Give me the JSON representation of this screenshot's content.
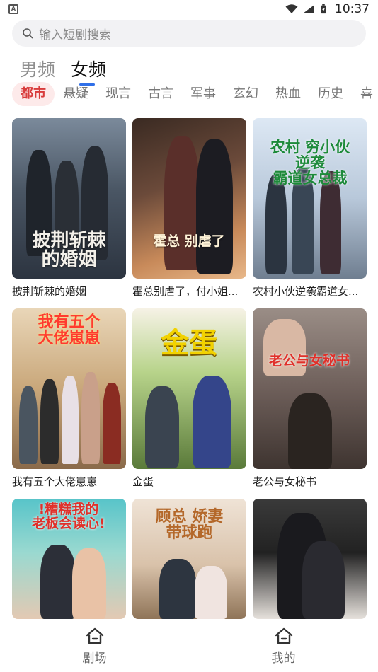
{
  "status_bar": {
    "time": "10:37",
    "app_icon_letter": "A"
  },
  "search": {
    "placeholder": "输入短剧搜索",
    "icon": "search-icon"
  },
  "channel_tabs": [
    {
      "label": "男频",
      "active": false
    },
    {
      "label": "女频",
      "active": true
    }
  ],
  "genres": [
    {
      "label": "都市",
      "active": true
    },
    {
      "label": "悬疑",
      "active": false
    },
    {
      "label": "现言",
      "active": false
    },
    {
      "label": "古言",
      "active": false
    },
    {
      "label": "军事",
      "active": false
    },
    {
      "label": "玄幻",
      "active": false
    },
    {
      "label": "热血",
      "active": false
    },
    {
      "label": "历史",
      "active": false
    },
    {
      "label": "喜",
      "active": false
    }
  ],
  "dramas": [
    {
      "title": "披荆斩棘的婚姻",
      "poster_text": "披荆斩棘\n的婚姻"
    },
    {
      "title": "霍总别虐了，付小姐...",
      "poster_text": "霍总 别虐了"
    },
    {
      "title": "农村小伙逆袭霸道女...",
      "poster_text": "农村 穷小伙\n逆袭\n霸道女总裁"
    },
    {
      "title": "我有五个大佬崽崽",
      "poster_text": "我有五个\n大佬崽崽"
    },
    {
      "title": "金蛋",
      "poster_text": "金蛋"
    },
    {
      "title": "老公与女秘书",
      "poster_text": "老公与女秘书"
    },
    {
      "title": "",
      "poster_text": "!糟糕我的\n老板会读心!"
    },
    {
      "title": "",
      "poster_text": "顾总 娇妻\n带球跑"
    },
    {
      "title": "",
      "poster_text": ""
    }
  ],
  "bottom_nav": [
    {
      "label": "剧场",
      "icon": "home-icon"
    },
    {
      "label": "我的",
      "icon": "home-icon"
    }
  ],
  "colors": {
    "accent_blue": "#2f6fe8",
    "genre_active_bg": "#fdeaea",
    "genre_active_text": "#d83c3c"
  }
}
